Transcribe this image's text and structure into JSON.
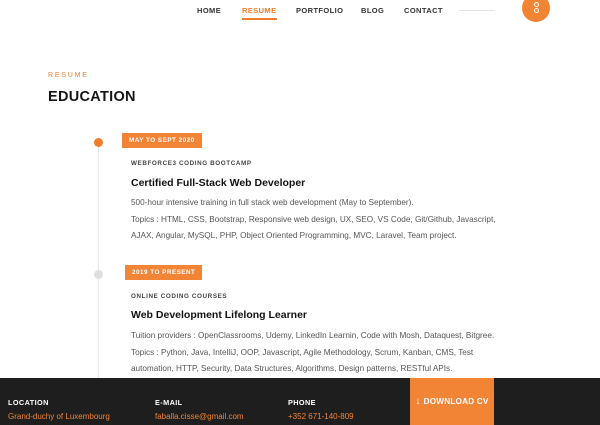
{
  "nav": {
    "items": [
      {
        "label": "HOME",
        "active": false
      },
      {
        "label": "RESUME",
        "active": true
      },
      {
        "label": "PORTFOLIO",
        "active": false
      },
      {
        "label": "BLOG",
        "active": false
      },
      {
        "label": "CONTACT",
        "active": false
      }
    ],
    "toggle_icon": "menu-toggle-icon"
  },
  "section": {
    "kicker": "RESUME",
    "title": "EDUCATION"
  },
  "entries": [
    {
      "period": "MAY TO SEPT 2020",
      "org": "WEBFORCE3 CODING BOOTCAMP",
      "title": "Certified Full-Stack Web Developer",
      "lines": [
        "500-hour intensive training in full stack web development (May to September).",
        "Topics : HTML, CSS, Bootstrap, Responsive web design, UX, SEO, VS Code, Git/Github, Javascript,",
        "AJAX, Angular, MySQL, PHP, Object Oriented Programming, MVC, Laravel, Team project."
      ]
    },
    {
      "period": "2019 TO PRESENT",
      "org": "ONLINE CODING COURSES",
      "title": "Web Development Lifelong Learner",
      "lines": [
        "Tuition providers : OpenClassrooms, Udemy, LinkedIn Learnin, Code with Mosh, Dataquest, Bitgree.",
        "Topics : Python, Java, IntelliJ, OOP, Javascript, Agile Methodology, Scrum, Kanban, CMS, Test",
        "automation, HTTP, Security, Data Structures, Algorithms, Design patterns, RESTful APIs."
      ]
    }
  ],
  "footer": {
    "location_label": "LOCATION",
    "location_value": "Grand-duchy of Luxembourg",
    "email_label": "E-MAIL",
    "email_value": "faballa.cisse@gmail.com",
    "phone_label": "PHONE",
    "phone_value": "+352 671-140-809",
    "download_label": "DOWNLOAD CV",
    "download_icon": "↓"
  },
  "colors": {
    "accent": "#f28436",
    "footer_bg": "#1e1e1e"
  }
}
